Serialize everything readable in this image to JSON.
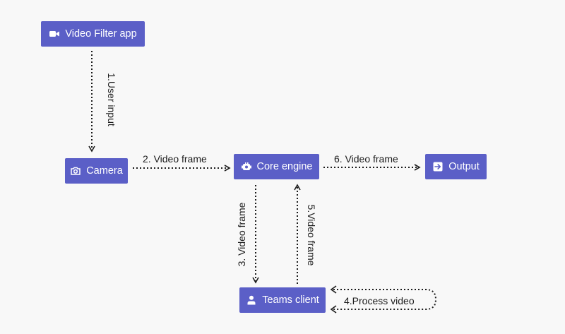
{
  "nodes": {
    "video_filter_app": {
      "label": "Video Filter app",
      "icon": "video-camera-icon"
    },
    "camera": {
      "label": "Camera",
      "icon": "camera-icon"
    },
    "core_engine": {
      "label": "Core engine",
      "icon": "engine-icon"
    },
    "output": {
      "label": "Output",
      "icon": "output-arrow-icon"
    },
    "teams_client": {
      "label": "Teams client",
      "icon": "person-icon"
    }
  },
  "edges": {
    "user_input": "1.User input",
    "camera_to_engine": "2. Video frame",
    "engine_to_teams": "3. Video frame",
    "process_video": "4.Process video",
    "teams_to_engine": "5.Video frame",
    "engine_to_output": "6. Video frame"
  },
  "colors": {
    "node_fill": "#5b5fc7",
    "node_text": "#ffffff",
    "edge": "#1c1c1c",
    "background": "#f8f8f8"
  }
}
